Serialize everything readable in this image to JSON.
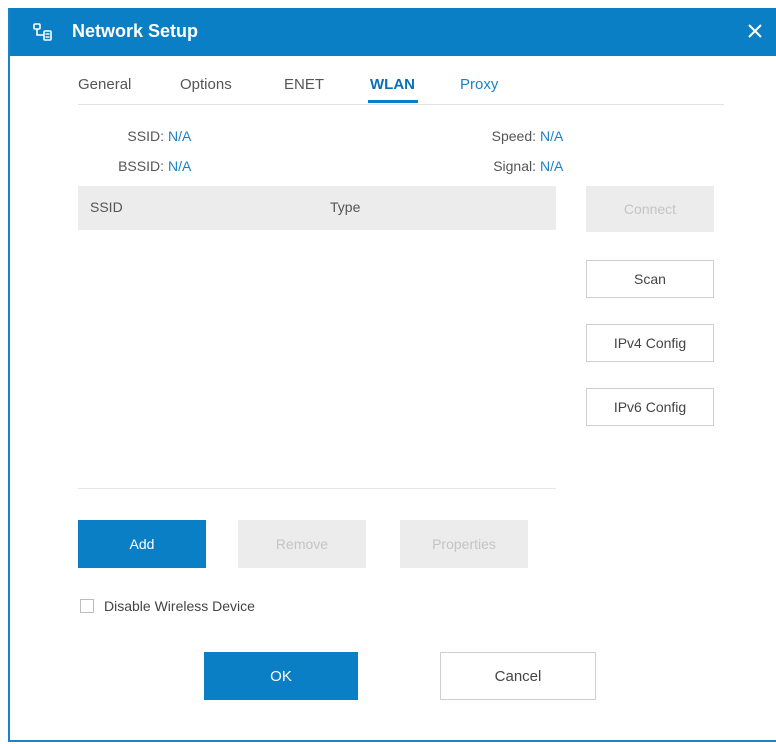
{
  "window": {
    "title": "Network Setup",
    "app_icon": "network-setup-icon",
    "close_icon": "close-icon",
    "accent_color": "#0b7fc6"
  },
  "tabs": [
    {
      "label": "General",
      "active": false
    },
    {
      "label": "Options",
      "active": false
    },
    {
      "label": "ENET",
      "active": false
    },
    {
      "label": "WLAN",
      "active": true
    },
    {
      "label": "Proxy",
      "active": false
    }
  ],
  "info": {
    "ssid_label": "SSID:",
    "ssid_value": "N/A",
    "bssid_label": "BSSID:",
    "bssid_value": "N/A",
    "speed_label": "Speed:",
    "speed_value": "N/A",
    "signal_label": "Signal:",
    "signal_value": "N/A"
  },
  "table": {
    "columns": [
      "SSID",
      "Type"
    ],
    "rows": []
  },
  "side_buttons": {
    "connect": "Connect",
    "scan": "Scan",
    "ipv4": "IPv4 Config",
    "ipv6": "IPv6 Config"
  },
  "actions": {
    "add": "Add",
    "remove": "Remove",
    "properties": "Properties"
  },
  "disable_wireless": {
    "label": "Disable Wireless Device",
    "checked": false
  },
  "footer": {
    "ok": "OK",
    "cancel": "Cancel"
  }
}
